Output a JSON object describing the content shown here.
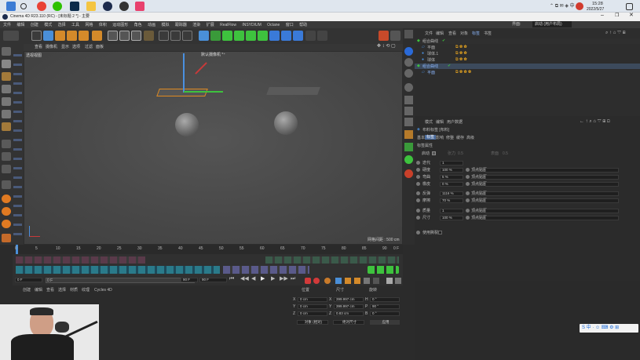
{
  "taskbar": {
    "time": "15:28",
    "date": "2022/5/27"
  },
  "window": {
    "title": "Cinema 4D R23.110 (RC) - [未标题 2 *] - 主要"
  },
  "menu": [
    "文件",
    "编辑",
    "创建",
    "模式",
    "选择",
    "工具",
    "网格",
    "体积",
    "运动图形",
    "角色",
    "动画",
    "模拟",
    "跟踪器",
    "渲染",
    "扩展",
    "RealFlow",
    "INSYDIUM",
    "Octane",
    "窗口",
    "帮助"
  ],
  "toolbar": {
    "interface_label": "界面:",
    "interface_value": "启动 (用户布局)"
  },
  "viewport": {
    "menu": [
      "查看",
      "摄像机",
      "显示",
      "选项",
      "过滤",
      "面板"
    ],
    "view_name": "透视视图",
    "camera_label": "默认摄像机 °⁺",
    "grid_spacing": "网格间距 : 500 cm"
  },
  "object_manager": {
    "tabs": [
      "文件",
      "编辑",
      "查看",
      "对象",
      "标签",
      "书签"
    ],
    "objects": [
      "组合曲线",
      "平面",
      "球体.1",
      "球体",
      "组合曲线",
      "平面"
    ]
  },
  "attribute_manager": {
    "tabs": [
      "模式",
      "编辑",
      "用户数据"
    ],
    "title": "布料标签 [布料]",
    "subtabs": [
      "基本",
      "标签",
      "影响",
      "修整",
      "缓存",
      "高级"
    ],
    "section": "标签属性",
    "enable_label": "启动",
    "tension_label": "张力",
    "tension_value": "0.5",
    "surface_label": "表面",
    "surface_value": "0.5",
    "rows": [
      {
        "label": "迭代",
        "value": "1",
        "map": ""
      },
      {
        "label": "硬度",
        "value": "100 %",
        "map": "顶点贴图"
      },
      {
        "label": "弯曲",
        "value": "5 %",
        "map": "顶点贴图"
      },
      {
        "label": "橡皮",
        "value": "0 %",
        "map": "顶点贴图"
      },
      {
        "label": "反弹",
        "value": "1116 %",
        "map": "顶点贴图"
      },
      {
        "label": "摩擦",
        "value": "70 %",
        "map": "顶点贴图"
      },
      {
        "label": "质量",
        "value": "1",
        "map": "顶点贴图"
      },
      {
        "label": "尺寸",
        "value": "100 %",
        "map": "顶点贴图"
      }
    ],
    "mesh_label": "使用撕裂"
  },
  "timeline": {
    "ticks": [
      "0",
      "5",
      "10",
      "15",
      "20",
      "25",
      "30",
      "35",
      "40",
      "45",
      "50",
      "55",
      "60",
      "65",
      "70",
      "75",
      "80",
      "85",
      "90"
    ],
    "current_frame": "0 F"
  },
  "playback": {
    "start": "0 F",
    "end_a": "90 F",
    "end_b": "90 F",
    "min": "0 F"
  },
  "material_manager": {
    "menu": [
      "创建",
      "编辑",
      "查看",
      "选择",
      "材质",
      "纹理",
      "Cycles 4D"
    ]
  },
  "coordinates": {
    "headers": [
      "位置",
      "尺寸",
      "旋转"
    ],
    "rows": [
      {
        "axis": "X",
        "pos": "0 cm",
        "size": "399.997 cm",
        "rot_axis": "H",
        "rot": "0 °"
      },
      {
        "axis": "Y",
        "pos": "0 cm",
        "size": "399.997 cm",
        "rot_axis": "P",
        "rot": "90 °"
      },
      {
        "axis": "Z",
        "pos": "0 cm",
        "size": "0.83 cm",
        "rot_axis": "B",
        "rot": "0 °"
      }
    ],
    "mode_a": "对象 (相对)",
    "mode_b": "绝对尺寸",
    "apply": "应用"
  },
  "colors": {
    "accent": "#4a8fd8",
    "play_green": "#3ec23e",
    "record_red": "#d23a3a"
  }
}
